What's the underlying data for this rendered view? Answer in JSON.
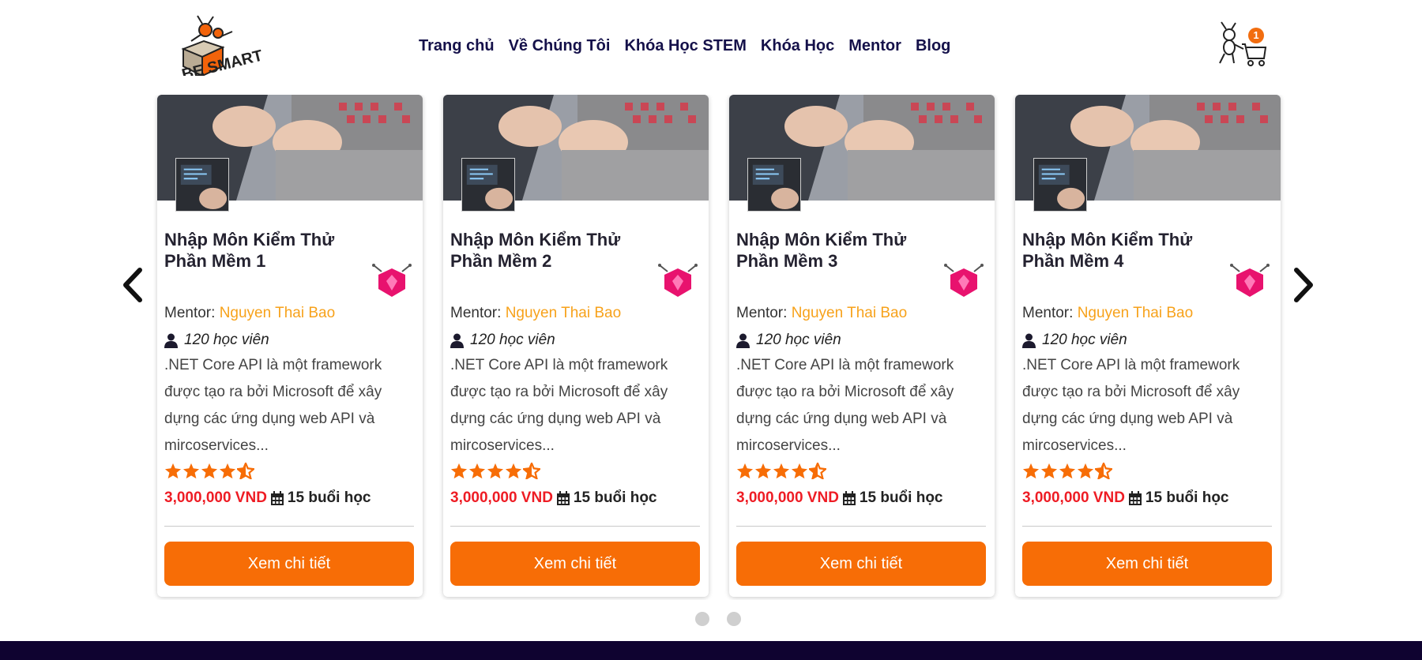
{
  "header": {
    "brand_logo": "BE SMART",
    "nav": [
      {
        "label": "Trang chủ"
      },
      {
        "label": "Về Chúng Tôi"
      },
      {
        "label": "Khóa Học STEM"
      },
      {
        "label": "Khóa Học"
      },
      {
        "label": "Mentor"
      },
      {
        "label": "Blog"
      }
    ],
    "cart_count": "1",
    "cart_icon": "ant-shopping-cart-icon"
  },
  "slider": {
    "prev_icon": "chevron-left-icon",
    "next_icon": "chevron-right-icon",
    "cards": [
      {
        "title": "Nhập Môn Kiểm Thử Phần Mềm 1",
        "mentor_label": "Mentor:",
        "mentor_name": "Nguyen Thai Bao",
        "students": "120 học viên",
        "description": ".NET Core API là một framework được tạo ra bởi Microsoft để xây dựng các ứng dụng web API và mircoservices...",
        "rating": 4.5,
        "price": "3,000,000 VND",
        "sessions": "15 buổi học",
        "button": "Xem chi tiết"
      },
      {
        "title": "Nhập Môn Kiểm Thử Phần Mềm 2",
        "mentor_label": "Mentor:",
        "mentor_name": "Nguyen Thai Bao",
        "students": "120 học viên",
        "description": ".NET Core API là một framework được tạo ra bởi Microsoft để xây dựng các ứng dụng web API và mircoservices...",
        "rating": 4.5,
        "price": "3,000,000 VND",
        "sessions": "15 buổi học",
        "button": "Xem chi tiết"
      },
      {
        "title": "Nhập Môn Kiểm Thử Phần Mềm 3",
        "mentor_label": "Mentor:",
        "mentor_name": "Nguyen Thai Bao",
        "students": "120 học viên",
        "description": ".NET Core API là một framework được tạo ra bởi Microsoft để xây dựng các ứng dụng web API và mircoservices...",
        "rating": 4.5,
        "price": "3,000,000 VND",
        "sessions": "15 buổi học",
        "button": "Xem chi tiết"
      },
      {
        "title": "Nhập Môn Kiểm Thử Phần Mềm 4",
        "mentor_label": "Mentor:",
        "mentor_name": "Nguyen Thai Bao",
        "students": "120 học viên",
        "description": ".NET Core API là một framework được tạo ra bởi Microsoft để xây dựng các ứng dụng web API và mircoservices...",
        "rating": 4.5,
        "price": "3,000,000 VND",
        "sessions": "15 buổi học",
        "button": "Xem chi tiết"
      }
    ],
    "dots": 2
  },
  "colors": {
    "nav_text": "#15114a",
    "accent_orange": "#f76d06",
    "star": "#f76d06",
    "price_red": "#ee1c24",
    "mentor_name": "#f7a21b",
    "footer": "#0f0330"
  }
}
